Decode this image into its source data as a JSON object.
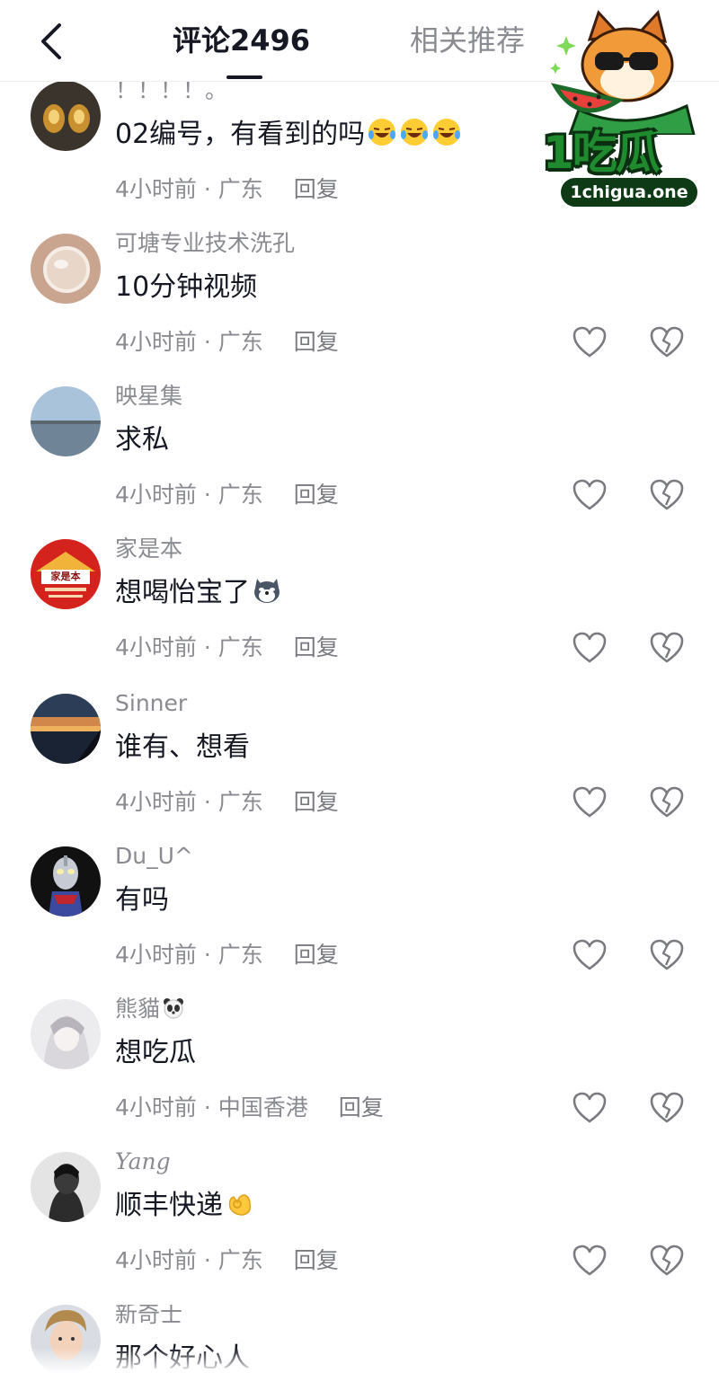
{
  "header": {
    "tab_comments": "评论2496",
    "tab_related": "相关推荐"
  },
  "logo": {
    "name": "1吃瓜",
    "url": "1chigua.one"
  },
  "comments": [
    {
      "username": "！！！！。",
      "text": "02编号，有看到的吗",
      "time": "4小时前 · 广东",
      "reply": "回复",
      "emoji": "laughing-tears-emoji-x3"
    },
    {
      "username": "可塘专业技术洗孔",
      "text": "10分钟视频",
      "time": "4小时前 · 广东",
      "reply": "回复"
    },
    {
      "username": "映星集",
      "text": "求私",
      "time": "4小时前 · 广东",
      "reply": "回复"
    },
    {
      "username": "家是本",
      "text": "想喝怡宝了",
      "time": "4小时前 · 广东",
      "reply": "回复",
      "emoji": "husky-emoji",
      "avatar_text": "家是本"
    },
    {
      "username": "Sinner",
      "text": "谁有、想看",
      "time": "4小时前 · 广东",
      "reply": "回复"
    },
    {
      "username": "Du_U^",
      "text": "有吗",
      "time": "4小时前 · 广东",
      "reply": "回复"
    },
    {
      "username": "熊貓",
      "text": "想吃瓜",
      "time": "4小时前 · 中国香港",
      "reply": "回复",
      "emoji": "panda-emoji"
    },
    {
      "username": "Yang",
      "text": "顺丰快递",
      "time": "4小时前 · 广东",
      "reply": "回复",
      "emoji": "ok-hand-emoji"
    },
    {
      "username": "新奇士",
      "text": "那个好心人",
      "time": "",
      "reply": ""
    }
  ],
  "icons": {
    "back": "chevron-left-icon",
    "like": "heart-outline-icon",
    "dislike": "broken-heart-icon"
  },
  "colors": {
    "primary_text": "#161823",
    "secondary_text": "#8a8b91",
    "logo_green": "#1f8a2e"
  }
}
